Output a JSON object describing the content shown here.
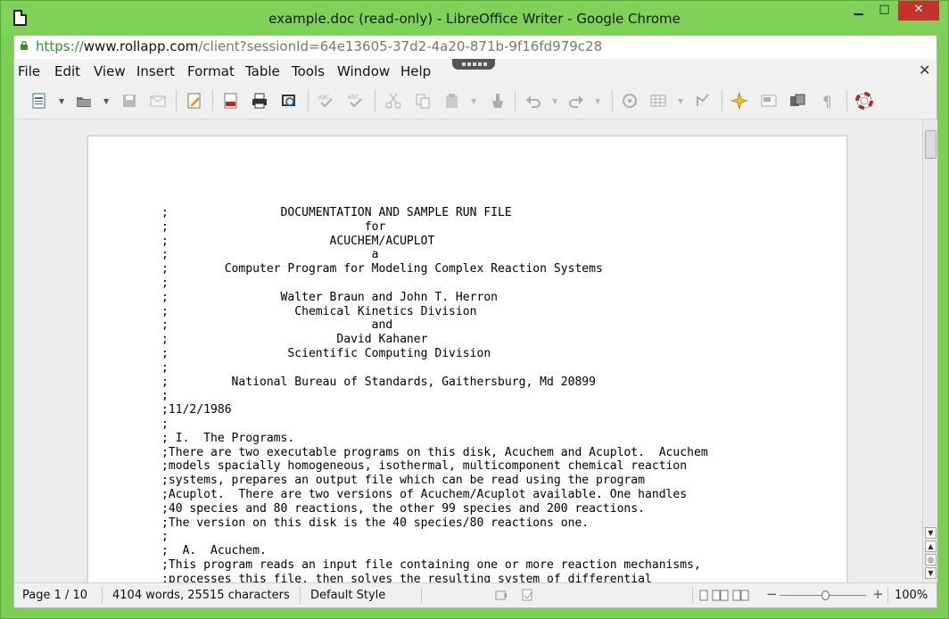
{
  "window": {
    "title": "example.doc (read-only) - LibreOffice Writer - Google Chrome",
    "minimize": "▁",
    "maximize": "□",
    "close": "✕"
  },
  "address": {
    "scheme": "https://",
    "host": "www.rollapp.com",
    "path": "/client?sessionId=64e13605-37d2-4a20-871b-9f16fd979c28"
  },
  "menu": [
    "File",
    "Edit",
    "View",
    "Insert",
    "Format",
    "Table",
    "Tools",
    "Window",
    "Help"
  ],
  "doc_close": "✕",
  "document": {
    "lines": [
      ";                DOCUMENTATION AND SAMPLE RUN FILE",
      ";                            for",
      ";                       ACUCHEM/ACUPLOT",
      ";                             a",
      ";        Computer Program for Modeling Complex Reaction Systems",
      ";",
      ";                Walter Braun and John T. Herron",
      ";                  Chemical Kinetics Division",
      ";                             and",
      ";                        David Kahaner",
      ";                 Scientific Computing Division",
      ";",
      ";         National Bureau of Standards, Gaithersburg, Md 20899",
      ";",
      ";11/2/1986",
      ";",
      "; I.  The Programs.",
      ";There are two executable programs on this disk, Acuchem and Acuplot.  Acuchem",
      ";models spacially homogeneous, isothermal, multicomponent chemical reaction",
      ";systems, prepares an output file which can be read using the program",
      ";Acuplot.  There are two versions of Acuchem/Acuplot available. One handles",
      ";40 species and 80 reactions, the other 99 species and 200 reactions.",
      ";The version on this disk is the 40 species/80 reactions one.",
      ";",
      ";  A.  Acuchem.",
      ";This program reads an input file containing one or more reaction mechanisms,",
      ";processes this file, then solves the resulting system of differential"
    ]
  },
  "status": {
    "page": "Page 1 / 10",
    "words": "4104 words, 25515 characters",
    "style": "Default Style",
    "zoom": "100%"
  },
  "colors": {
    "chrome_frame": "#7dd257",
    "close_button": "#c7312b",
    "url_scheme": "#2a9a2a"
  }
}
